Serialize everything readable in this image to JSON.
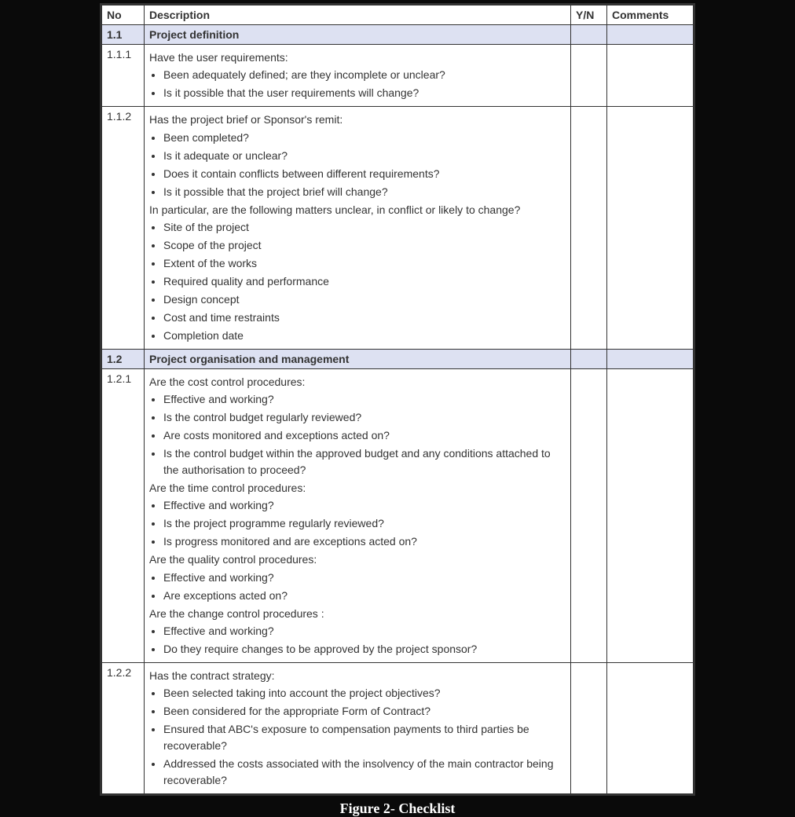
{
  "headers": {
    "no": "No",
    "description": "Description",
    "yn": "Y/N",
    "comments": "Comments"
  },
  "caption": "Figure 2- Checklist",
  "rows": [
    {
      "type": "section",
      "no": "1.1",
      "description_lead": "Project definition"
    },
    {
      "type": "item",
      "no": "1.1.1",
      "blocks": [
        {
          "kind": "lead",
          "text": "Have the user requirements:"
        },
        {
          "kind": "bullets",
          "items": [
            "Been adequately defined; are they incomplete or unclear?",
            "Is it possible that the user requirements will change?"
          ]
        }
      ]
    },
    {
      "type": "item",
      "no": "1.1.2",
      "blocks": [
        {
          "kind": "lead",
          "text": "Has the project brief or Sponsor's remit:"
        },
        {
          "kind": "bullets",
          "items": [
            "Been completed?",
            "Is it adequate or unclear?",
            "Does it contain conflicts between different requirements?",
            "Is it possible that the project brief will change?"
          ]
        },
        {
          "kind": "lead",
          "text": "In particular, are the following matters unclear, in conflict or likely to change?"
        },
        {
          "kind": "bullets",
          "items": [
            "Site of the project",
            "Scope of the project",
            "Extent of the works",
            "Required quality and performance",
            "Design concept",
            "Cost and time restraints",
            "Completion date"
          ]
        }
      ]
    },
    {
      "type": "section",
      "no": "1.2",
      "description_lead": "Project organisation and management"
    },
    {
      "type": "item",
      "no": "1.2.1",
      "blocks": [
        {
          "kind": "lead",
          "text": "Are the cost control procedures:"
        },
        {
          "kind": "bullets",
          "items": [
            "Effective and working?",
            "Is the control budget regularly reviewed?",
            "Are costs monitored and exceptions acted on?",
            "Is the control budget within the approved budget and any conditions attached to the authorisation to proceed?"
          ]
        },
        {
          "kind": "lead",
          "text": "Are the time control procedures:"
        },
        {
          "kind": "bullets",
          "items": [
            "Effective and working?",
            "Is the project programme regularly reviewed?",
            "Is progress monitored and are exceptions acted on?"
          ]
        },
        {
          "kind": "lead",
          "text": "Are the quality control procedures:"
        },
        {
          "kind": "bullets",
          "items": [
            "Effective and working?",
            "Are exceptions acted on?"
          ]
        },
        {
          "kind": "lead",
          "text": "Are the change control procedures :"
        },
        {
          "kind": "bullets",
          "items": [
            "Effective and working?",
            "Do they require changes to be approved by the project sponsor?"
          ]
        }
      ]
    },
    {
      "type": "item",
      "no": "1.2.2",
      "blocks": [
        {
          "kind": "lead",
          "text": "Has the contract strategy:"
        },
        {
          "kind": "bullets",
          "items": [
            "Been selected taking into account the project objectives?",
            "Been considered for the appropriate Form of Contract?",
            "Ensured that ABC's exposure to compensation payments to third parties be recoverable?",
            "Addressed the costs associated with the insolvency of the main contractor being recoverable?"
          ]
        }
      ]
    }
  ]
}
